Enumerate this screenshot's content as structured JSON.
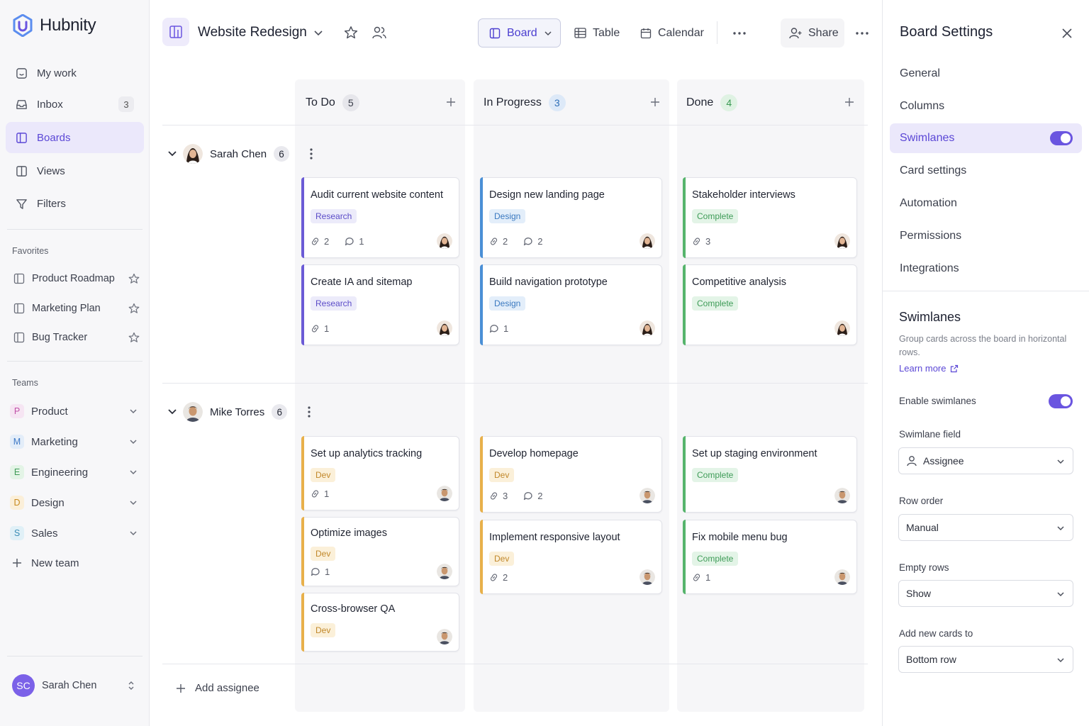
{
  "app": {
    "name": "Hubnity"
  },
  "sidebar": {
    "nav": [
      {
        "label": "My work",
        "count": ""
      },
      {
        "label": "Inbox",
        "count": "3"
      },
      {
        "label": "Boards",
        "count": ""
      },
      {
        "label": "Views",
        "count": ""
      },
      {
        "label": "Filters",
        "count": ""
      }
    ],
    "favorites_label": "Favorites",
    "favorites": [
      "Product Roadmap",
      "Marketing Plan",
      "Bug Tracker"
    ],
    "teams_label": "Teams",
    "teams": [
      {
        "letter": "P",
        "name": "Product"
      },
      {
        "letter": "M",
        "name": "Marketing"
      },
      {
        "letter": "E",
        "name": "Engineering"
      },
      {
        "letter": "D",
        "name": "Design"
      },
      {
        "letter": "S",
        "name": "Sales"
      }
    ],
    "new_team": "New team",
    "user": {
      "initials": "SC",
      "name": "Sarah Chen"
    }
  },
  "header": {
    "board_title": "Website Redesign",
    "views": {
      "board": "Board",
      "table": "Table",
      "calendar": "Calendar"
    },
    "share": "Share"
  },
  "columns": [
    {
      "name": "To Do",
      "count": "5"
    },
    {
      "name": "In Progress",
      "count": "3"
    },
    {
      "name": "Done",
      "count": "4"
    }
  ],
  "lanes": [
    {
      "name": "Sarah Chen",
      "count": "6",
      "cards": [
        {
          "title": "Audit current website content",
          "tag": "Research",
          "links": "2",
          "comments": "1"
        },
        {
          "title": "Create IA and sitemap",
          "tag": "Research",
          "links": "1",
          "comments": ""
        },
        {
          "title": "Design new landing page",
          "tag": "Design",
          "links": "2",
          "comments": "2"
        },
        {
          "title": "Build navigation prototype",
          "tag": "Design",
          "links": "",
          "comments": "1"
        },
        {
          "title": "Stakeholder interviews",
          "tag": "Complete",
          "links": "3",
          "comments": ""
        },
        {
          "title": "Competitive analysis",
          "tag": "Complete",
          "links": "",
          "comments": ""
        }
      ]
    },
    {
      "name": "Mike Torres",
      "count": "6",
      "cards": [
        {
          "title": "Set up analytics tracking",
          "tag": "Dev",
          "links": "1",
          "comments": ""
        },
        {
          "title": "Optimize images",
          "tag": "Dev",
          "links": "",
          "comments": "1"
        },
        {
          "title": "Cross-browser QA",
          "tag": "Dev",
          "links": "",
          "comments": ""
        },
        {
          "title": "Develop homepage",
          "tag": "Dev",
          "links": "3",
          "comments": "2"
        },
        {
          "title": "Implement responsive layout",
          "tag": "Dev",
          "links": "2",
          "comments": ""
        },
        {
          "title": "Set up staging environment",
          "tag": "Complete",
          "links": "",
          "comments": ""
        },
        {
          "title": "Fix mobile menu bug",
          "tag": "Complete",
          "links": "1",
          "comments": ""
        }
      ]
    }
  ],
  "add_assignee": "Add assignee",
  "panel": {
    "title": "Board Settings",
    "nav": [
      "General",
      "Columns",
      "Swimlanes",
      "Card settings",
      "Automation",
      "Permissions",
      "Integrations"
    ],
    "section_title": "Swimlanes",
    "section_desc": "Group cards across the board in horizontal rows.",
    "learn_more": "Learn more",
    "enable_label": "Enable swimlanes",
    "field_label": "Swimlane field",
    "field_value": "Assignee",
    "row_order_label": "Row order",
    "row_order_value": "Manual",
    "empty_rows_label": "Empty rows",
    "empty_rows_value": "Show",
    "add_cards_label": "Add new cards to",
    "add_cards_value": "Bottom row"
  },
  "colors": {
    "accent": "#6a55e0",
    "research": "#6b5bd6",
    "design": "#4a8fd6",
    "complete": "#56b46c",
    "dev": "#e8b04a"
  }
}
